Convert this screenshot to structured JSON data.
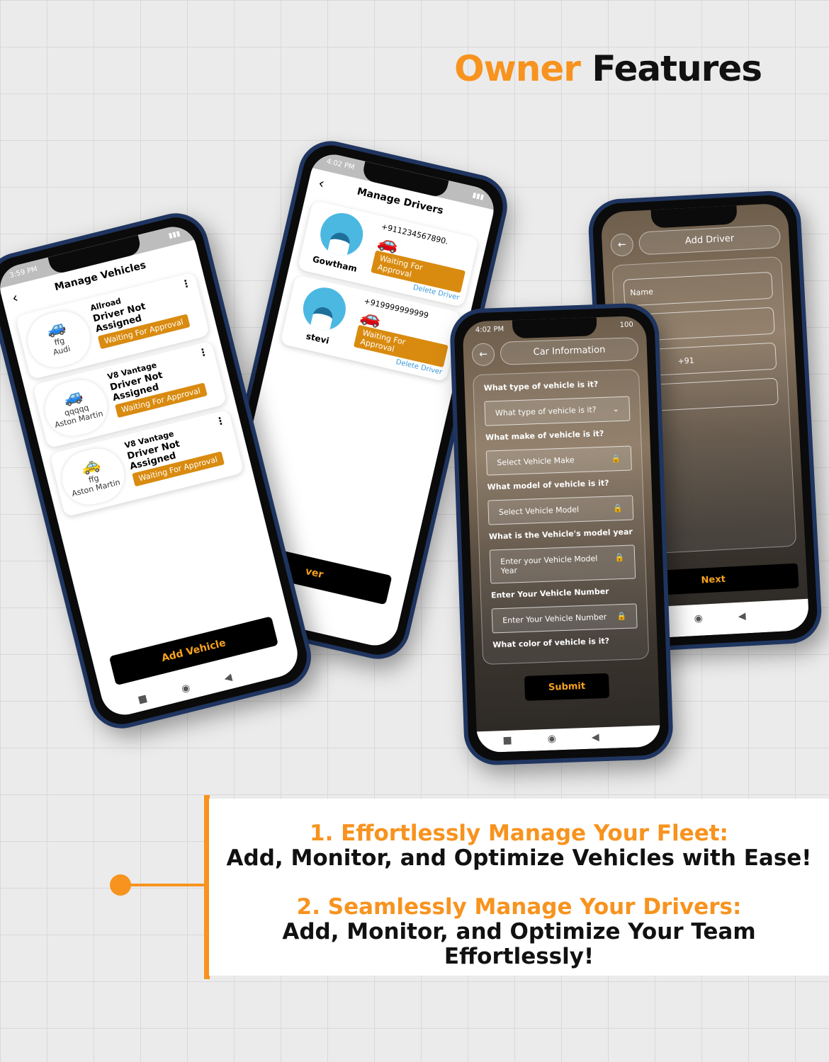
{
  "title": {
    "accent": "Owner",
    "rest": "Features"
  },
  "colors": {
    "accent": "#f7931e",
    "badge": "#d98b10",
    "link": "#3a9ad9"
  },
  "vehicles_screen": {
    "time": "3:59 PM",
    "title": "Manage Vehicles",
    "items": [
      {
        "name": "ffg",
        "make": "Audi",
        "model": "Allroad",
        "driver": "Driver Not Assigned",
        "status": "Waiting For Approval",
        "icon": "car-white"
      },
      {
        "name": "qqqqq",
        "make": "Aston Martin",
        "model": "V8 Vantage",
        "driver": "Driver Not Assigned",
        "status": "Waiting For Approval",
        "icon": "car-white"
      },
      {
        "name": "ffg",
        "make": "Aston Martin",
        "model": "V8 Vantage",
        "driver": "Driver Not Assigned",
        "status": "Waiting For Approval",
        "icon": "car-orange"
      }
    ],
    "add_button": "Add Vehicle"
  },
  "drivers_screen": {
    "time": "4:02 PM",
    "title": "Manage Drivers",
    "items": [
      {
        "name": "Gowtham",
        "phone": "+911234567890.",
        "status": "Waiting For Approval",
        "delete": "Delete Driver"
      },
      {
        "name": "stevi",
        "phone": "+919999999999",
        "status": "Waiting For Approval",
        "delete": "Delete Driver"
      }
    ],
    "partial_button": "ver"
  },
  "add_driver_screen": {
    "title": "Add Driver",
    "name_placeholder": "Name",
    "phone_prefix": "+91",
    "next": "Next"
  },
  "car_info_screen": {
    "time": "4:02 PM",
    "battery": "100",
    "title": "Car Information",
    "q1": "What type of vehicle is it?",
    "f1": "What type of vehicle is it?",
    "q2": "What make of vehicle is it?",
    "f2": "Select Vehicle Make",
    "q3": "What model of vehicle is it?",
    "f3": "Select Vehicle Model",
    "q4": "What is the Vehicle's model year",
    "f4": "Enter your Vehicle Model Year",
    "q5": "Enter Your Vehicle Number",
    "f5": "Enter Your Vehicle Number",
    "q6": "What color of vehicle is it?",
    "submit": "Submit"
  },
  "features": [
    {
      "heading": "1. Effortlessly Manage Your Fleet:",
      "text": "Add, Monitor, and Optimize Vehicles with Ease!"
    },
    {
      "heading": "2. Seamlessly Manage Your Drivers:",
      "text": "Add, Monitor, and Optimize Your Team Effortlessly!"
    }
  ]
}
